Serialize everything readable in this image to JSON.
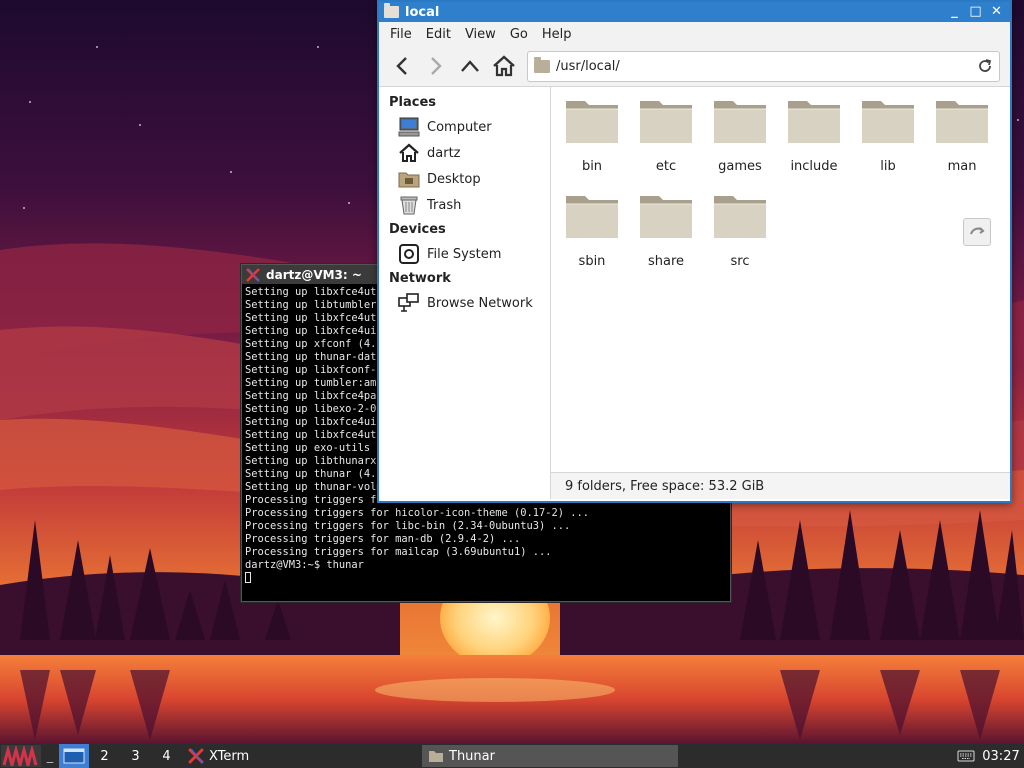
{
  "colors": {
    "thunar_titlebar": "#2f80cc",
    "taskbar_bg": "#2c2c2c",
    "workspace_active": "#3f7fd1",
    "terminal_bg": "#000000"
  },
  "xterm": {
    "title": "dartz@VM3: ~",
    "lines": [
      "Setting up libxfce4uti",
      "Setting up libtumbler-",
      "Setting up libxfce4uti",
      "Setting up libxfce4ui-",
      "Setting up xfconf (4.1",
      "Setting up thunar-data",
      "Setting up libxfconf-0",
      "Setting up tumbler:amd",
      "Setting up libxfce4pan",
      "Setting up libexo-2-0:",
      "Setting up libxfce4ui-",
      "Setting up libxfce4uti",
      "Setting up exo-utils (",
      "Setting up libthunarx-",
      "Setting up thunar (4.1",
      "Setting up thunar-volm",
      "Processing triggers fo",
      "Processing triggers for hicolor-icon-theme (0.17-2) ...",
      "Processing triggers for libc-bin (2.34-0ubuntu3) ...",
      "Processing triggers for man-db (2.9.4-2) ...",
      "Processing triggers for mailcap (3.69ubuntu1) ...",
      "dartz@VM3:~$ thunar"
    ]
  },
  "thunar": {
    "title": "local",
    "window_buttons": {
      "minimize": "_",
      "maximize": "□",
      "close": "✕"
    },
    "menu": [
      "File",
      "Edit",
      "View",
      "Go",
      "Help"
    ],
    "toolbar": {
      "back_icon": "chevron-left-icon",
      "forward_icon": "chevron-right-icon",
      "up_icon": "chevron-up-icon",
      "home_icon": "home-icon",
      "reload_icon": "reload-icon"
    },
    "location": "/usr/local/",
    "sidebar": {
      "places_heading": "Places",
      "places": [
        {
          "label": "Computer",
          "icon": "computer-icon"
        },
        {
          "label": "dartz",
          "icon": "home-icon"
        },
        {
          "label": "Desktop",
          "icon": "desktop-folder-icon"
        },
        {
          "label": "Trash",
          "icon": "trash-icon"
        }
      ],
      "devices_heading": "Devices",
      "devices": [
        {
          "label": "File System",
          "icon": "drive-icon"
        }
      ],
      "network_heading": "Network",
      "network": [
        {
          "label": "Browse Network",
          "icon": "network-icon"
        }
      ]
    },
    "folders": [
      "bin",
      "etc",
      "games",
      "include",
      "lib",
      "man",
      "sbin",
      "share",
      "src"
    ],
    "status": "9 folders, Free space: 53.2 GiB"
  },
  "taskbar": {
    "workspaces": [
      "2",
      "3",
      "4"
    ],
    "tasks": [
      {
        "label": "XTerm",
        "icon": "xterm-icon"
      },
      {
        "label": "Thunar",
        "icon": "folder-icon"
      }
    ],
    "clock": "03:27"
  }
}
